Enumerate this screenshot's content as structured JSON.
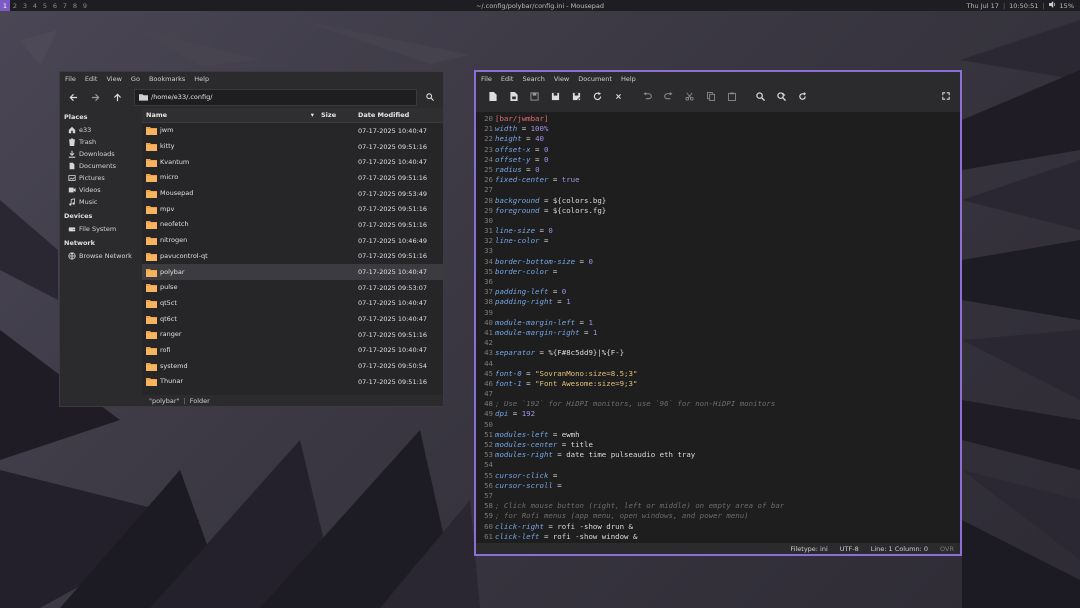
{
  "topbar": {
    "workspaces": [
      "1",
      "2",
      "3",
      "4",
      "5",
      "6",
      "7",
      "8",
      "9"
    ],
    "active_workspace": "1",
    "window_title": "~/.config/polybar/config.ini - Mousepad",
    "date": "Thu Jul 17",
    "time": "10:50:51",
    "volume": "15%"
  },
  "file_manager": {
    "menu": [
      "File",
      "Edit",
      "View",
      "Go",
      "Bookmarks",
      "Help"
    ],
    "path": "/home/e33/.config/",
    "sidebar": {
      "places_heading": "Places",
      "places": [
        {
          "label": "e33",
          "icon": "home-icon"
        },
        {
          "label": "Trash",
          "icon": "trash-icon"
        },
        {
          "label": "Downloads",
          "icon": "download-icon"
        },
        {
          "label": "Documents",
          "icon": "documents-icon"
        },
        {
          "label": "Pictures",
          "icon": "pictures-icon"
        },
        {
          "label": "Videos",
          "icon": "videos-icon"
        },
        {
          "label": "Music",
          "icon": "music-icon"
        }
      ],
      "devices_heading": "Devices",
      "devices": [
        {
          "label": "File System",
          "icon": "drive-icon"
        }
      ],
      "network_heading": "Network",
      "network": [
        {
          "label": "Browse Network",
          "icon": "network-icon"
        }
      ]
    },
    "columns": {
      "name": "Name",
      "size": "Size",
      "date": "Date Modified"
    },
    "files": [
      {
        "name": "jwm",
        "date": "07-17-2025 10:40:47"
      },
      {
        "name": "kitty",
        "date": "07-17-2025 09:51:16"
      },
      {
        "name": "Kvantum",
        "date": "07-17-2025 10:40:47"
      },
      {
        "name": "micro",
        "date": "07-17-2025 09:51:16"
      },
      {
        "name": "Mousepad",
        "date": "07-17-2025 09:53:49"
      },
      {
        "name": "mpv",
        "date": "07-17-2025 09:51:16"
      },
      {
        "name": "neofetch",
        "date": "07-17-2025 09:51:16"
      },
      {
        "name": "nitrogen",
        "date": "07-17-2025 10:46:49"
      },
      {
        "name": "pavucontrol-qt",
        "date": "07-17-2025 09:51:16"
      },
      {
        "name": "polybar",
        "date": "07-17-2025 10:40:47"
      },
      {
        "name": "pulse",
        "date": "07-17-2025 09:53:07"
      },
      {
        "name": "qt5ct",
        "date": "07-17-2025 10:40:47"
      },
      {
        "name": "qt6ct",
        "date": "07-17-2025 10:40:47"
      },
      {
        "name": "ranger",
        "date": "07-17-2025 09:51:16"
      },
      {
        "name": "rofi",
        "date": "07-17-2025 10:40:47"
      },
      {
        "name": "systemd",
        "date": "07-17-2025 09:50:54"
      },
      {
        "name": "Thunar",
        "date": "07-17-2025 09:51:16"
      }
    ],
    "selected_file": "polybar",
    "status": {
      "selection": "\"polybar\"",
      "type": "Folder"
    }
  },
  "editor": {
    "menu": [
      "File",
      "Edit",
      "Search",
      "View",
      "Document",
      "Help"
    ],
    "toolbar_icons": [
      "new-file-icon",
      "new-window-icon",
      "open-icon",
      "save-icon",
      "save-as-icon",
      "reload-icon",
      "close-icon",
      "undo-icon",
      "redo-icon",
      "cut-icon",
      "copy-icon",
      "paste-icon",
      "find-icon",
      "find-replace-icon",
      "goto-icon",
      "fullscreen-icon"
    ],
    "lines": [
      {
        "n": "20",
        "t": "[bar/jwmbar]"
      },
      {
        "n": "21",
        "t": "width = 100%"
      },
      {
        "n": "22",
        "t": "height = 40"
      },
      {
        "n": "23",
        "t": "offset-x = 0"
      },
      {
        "n": "24",
        "t": "offset-y = 0"
      },
      {
        "n": "25",
        "t": "radius = 0"
      },
      {
        "n": "26",
        "t": "fixed-center = true"
      },
      {
        "n": "27",
        "t": ""
      },
      {
        "n": "28",
        "t": "background = ${colors.bg}"
      },
      {
        "n": "29",
        "t": "foreground = ${colors.fg}"
      },
      {
        "n": "30",
        "t": ""
      },
      {
        "n": "31",
        "t": "line-size = 0"
      },
      {
        "n": "32",
        "t": "line-color ="
      },
      {
        "n": "33",
        "t": ""
      },
      {
        "n": "34",
        "t": "border-bottom-size = 0"
      },
      {
        "n": "35",
        "t": "border-color ="
      },
      {
        "n": "36",
        "t": ""
      },
      {
        "n": "37",
        "t": "padding-left = 0"
      },
      {
        "n": "38",
        "t": "padding-right = 1"
      },
      {
        "n": "39",
        "t": ""
      },
      {
        "n": "40",
        "t": "module-margin-left = 1"
      },
      {
        "n": "41",
        "t": "module-margin-right = 1"
      },
      {
        "n": "42",
        "t": ""
      },
      {
        "n": "43",
        "t": "separator = %{F#8c5dd9}|%{F-}"
      },
      {
        "n": "44",
        "t": ""
      },
      {
        "n": "45",
        "t": "font-0 = \"SovranMono:size=8.5;3\""
      },
      {
        "n": "46",
        "t": "font-1 = \"Font Awesome:size=9;3\""
      },
      {
        "n": "47",
        "t": ""
      },
      {
        "n": "48",
        "t": "; Use `192` for HiDPI monitors, use `96` for non-HiDPI monitors"
      },
      {
        "n": "49",
        "t": "dpi = 192"
      },
      {
        "n": "50",
        "t": ""
      },
      {
        "n": "51",
        "t": "modules-left = ewmh"
      },
      {
        "n": "52",
        "t": "modules-center = title"
      },
      {
        "n": "53",
        "t": "modules-right = date time pulseaudio eth tray"
      },
      {
        "n": "54",
        "t": ""
      },
      {
        "n": "55",
        "t": "cursor-click ="
      },
      {
        "n": "56",
        "t": "cursor-scroll ="
      },
      {
        "n": "57",
        "t": ""
      },
      {
        "n": "58",
        "t": "; Click mouse button (right, left or middle) on empty area of bar"
      },
      {
        "n": "59",
        "t": "; for Rofi menus (app menu, open windows, and power menu)"
      },
      {
        "n": "60",
        "t": "click-right = rofi -show drun &"
      },
      {
        "n": "61",
        "t": "click-left = rofi -show window &"
      }
    ],
    "status": {
      "filetype": "Filetype: ini",
      "encoding": "UTF-8",
      "position": "Line: 1 Column: 0",
      "mode": "OVR"
    }
  },
  "colors": {
    "accent": "#8b6fd6",
    "workspace_active": "#7c5cc4",
    "folder": "#f0a24a",
    "key": "#76a6e8",
    "number": "#a98fe6",
    "string": "#e3c07a"
  }
}
